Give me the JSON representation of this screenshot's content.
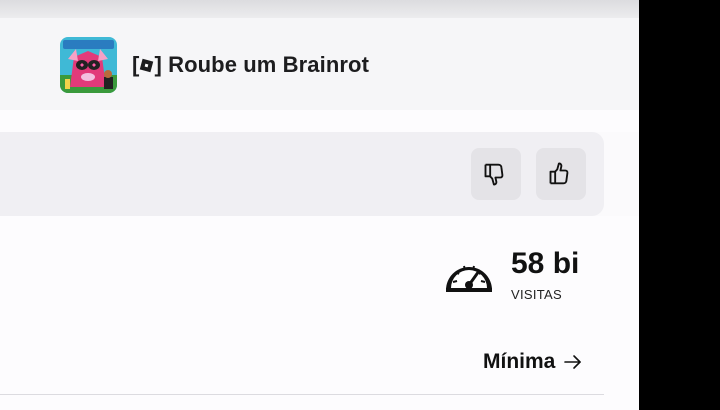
{
  "game": {
    "title_logo_icon": "roblox-logo-icon",
    "title": "Roube um Brainrot"
  },
  "votes": {
    "dislike_icon": "thumbs-down-icon",
    "like_icon": "thumbs-up-icon"
  },
  "stats": {
    "visits_value": "58 bi",
    "visits_label": "VISITAS",
    "gauge_icon": "speedometer-icon"
  },
  "link": {
    "label": "Mínima",
    "arrow_icon": "arrow-right-icon"
  }
}
